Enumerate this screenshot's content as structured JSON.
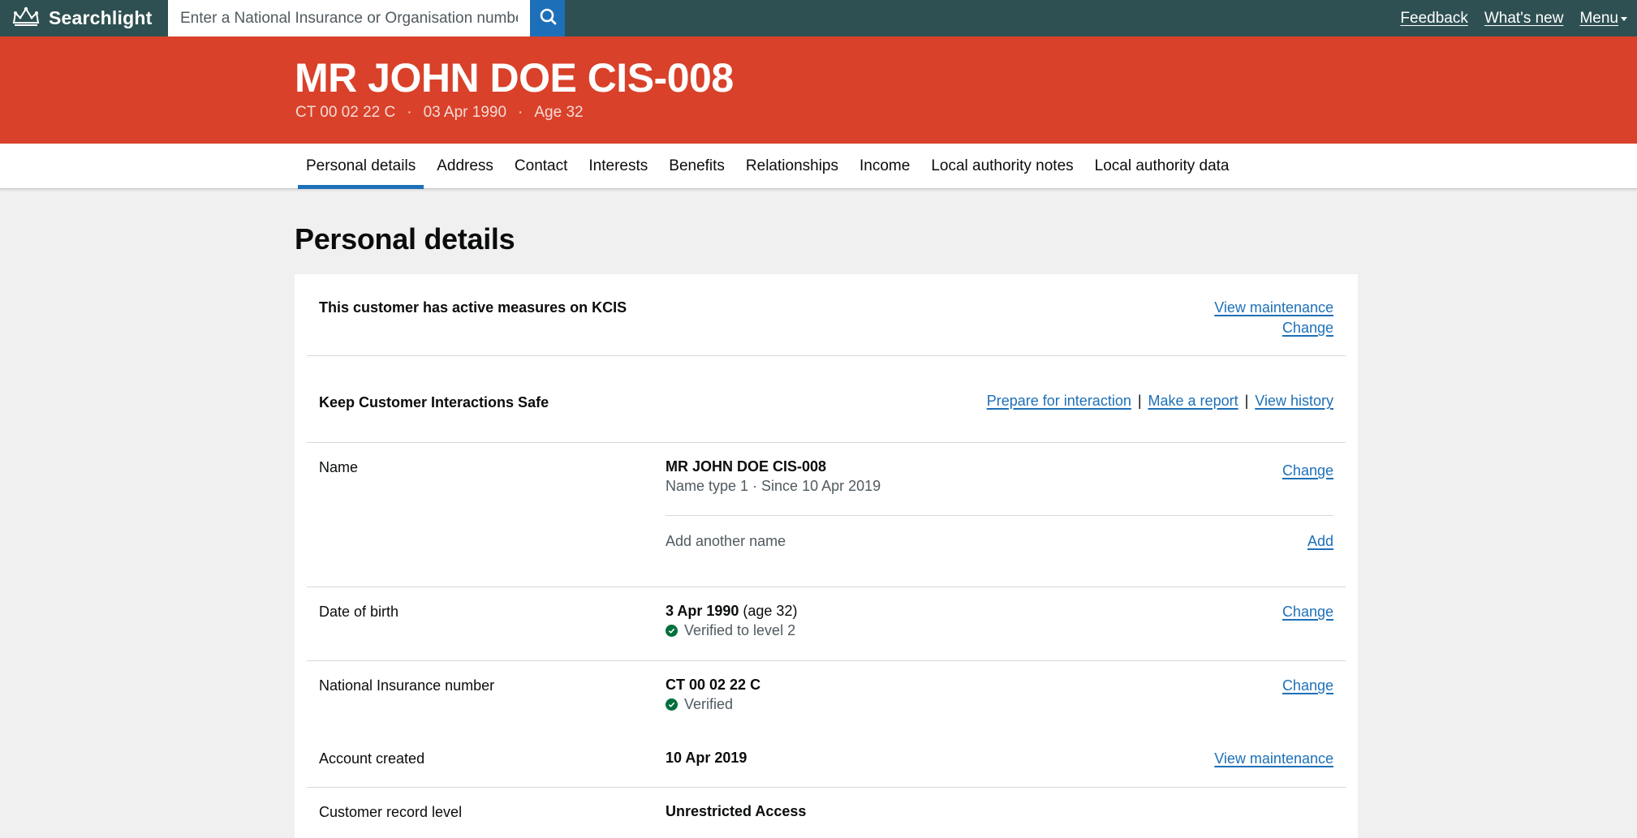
{
  "topbar": {
    "brand": "Searchlight",
    "search_placeholder": "Enter a National Insurance or Organisation number",
    "links": [
      "Feedback",
      "What's new",
      "Menu"
    ]
  },
  "customer": {
    "name": "MR JOHN DOE CIS-008",
    "nino": "CT 00 02 22 C",
    "dob": "03 Apr 1990",
    "age": "Age 32",
    "separator": "·"
  },
  "tabs": [
    "Personal details",
    "Address",
    "Contact",
    "Interests",
    "Benefits",
    "Relationships",
    "Income",
    "Local authority notes",
    "Local authority data"
  ],
  "active_tab": "Personal details",
  "page": {
    "title": "Personal details"
  },
  "kcis": {
    "message": "This customer has active measures on KCIS",
    "view_maintenance": "View maintenance",
    "change": "Change"
  },
  "kics": {
    "title": "Keep Customer Interactions Safe",
    "links": [
      "Prepare for interaction",
      "Make a report",
      "View history"
    ],
    "separator": "|"
  },
  "details": {
    "name": {
      "key": "Name",
      "value": "MR JOHN DOE CIS-008",
      "sub": "Name type 1 · Since 10 Apr 2019",
      "action": "Change",
      "add_text": "Add another name",
      "add_action": "Add"
    },
    "dob": {
      "key": "Date of birth",
      "value": "3 Apr 1990",
      "value_suffix": "(age 32)",
      "status": "Verified to level 2",
      "action": "Change"
    },
    "nino": {
      "key": "National Insurance number",
      "value": "CT 00 02 22 C",
      "status": "Verified",
      "action": "Change"
    },
    "account_created": {
      "key": "Account created",
      "value": "10 Apr 2019",
      "action": "View maintenance"
    },
    "record_level": {
      "key": "Customer record level",
      "value": "Unrestricted Access"
    }
  },
  "colors": {
    "topbar": "#2f5052",
    "header": "#d9412a",
    "link": "#1d70b8",
    "verified": "#00703c",
    "background": "#f0f0f0"
  },
  "icons": [
    "crown-icon",
    "search-icon",
    "chevron-down-icon",
    "check-circle-icon"
  ]
}
